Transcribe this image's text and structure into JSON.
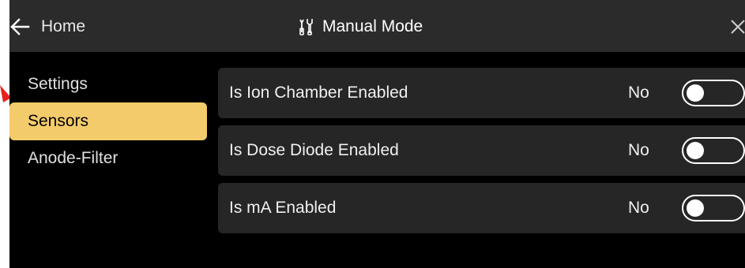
{
  "header": {
    "back_label": "Home",
    "title": "Manual Mode",
    "title_icon": "tools-icon",
    "close_icon": "close-icon"
  },
  "sidebar": {
    "items": [
      {
        "label": "Settings",
        "active": false
      },
      {
        "label": "Sensors",
        "active": true
      },
      {
        "label": "Anode-Filter",
        "active": false
      }
    ]
  },
  "settings": [
    {
      "label": "Is Ion Chamber Enabled",
      "value": "No",
      "enabled": false
    },
    {
      "label": "Is Dose Diode Enabled",
      "value": "No",
      "enabled": false
    },
    {
      "label": "Is mA Enabled",
      "value": "No",
      "enabled": false
    }
  ],
  "colors": {
    "accent": "#f4cb6a",
    "background": "#000000",
    "header_bg": "#2b2b2b",
    "row_bg": "#262626",
    "annotation_arrow": "#e8201c"
  }
}
